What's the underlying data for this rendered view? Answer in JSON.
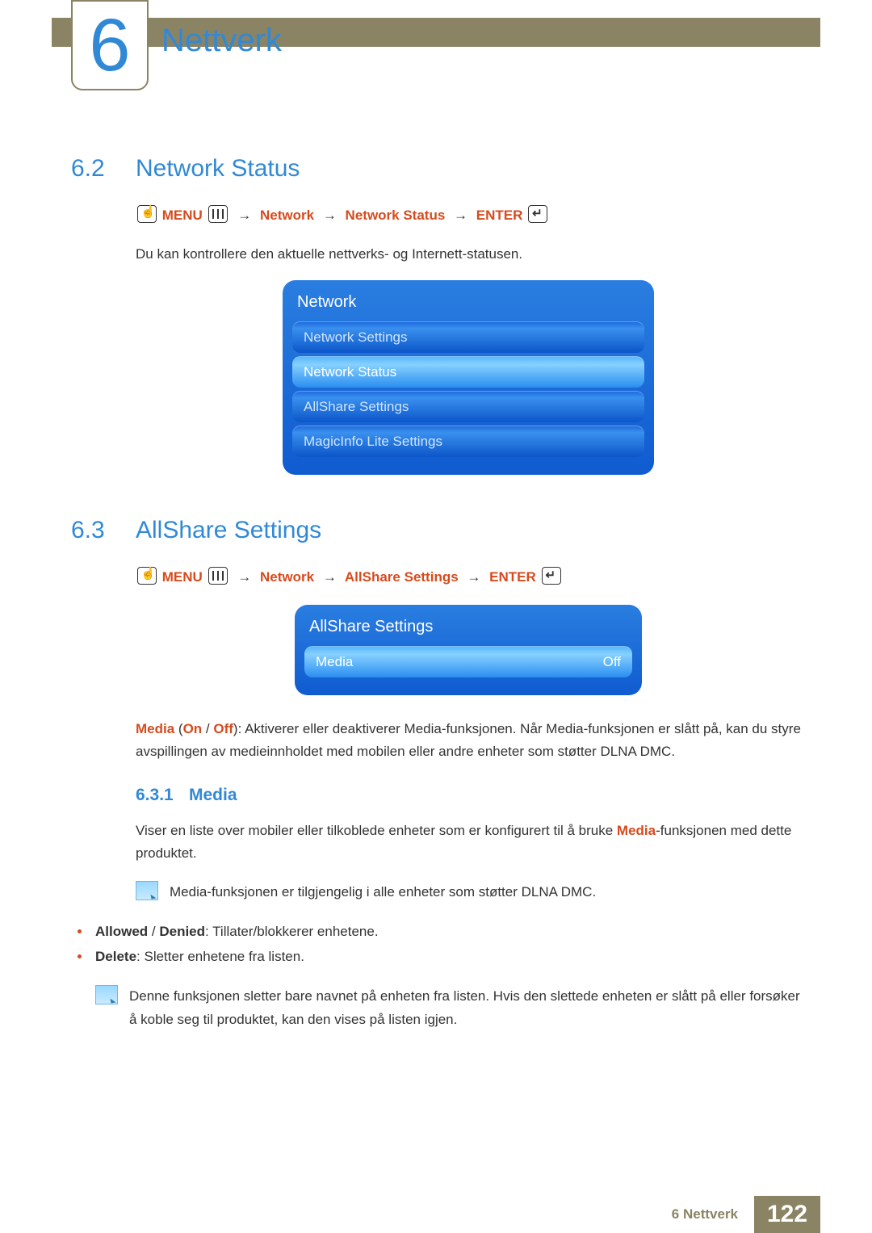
{
  "chapter": {
    "number": "6",
    "title": "Nettverk"
  },
  "sec62": {
    "num": "6.2",
    "title": "Network Status",
    "path": {
      "menu": "MENU",
      "n1": "Network",
      "n2": "Network Status",
      "enter": "ENTER"
    },
    "desc": "Du kan kontrollere den aktuelle nettverks- og Internett-statusen.",
    "panel": {
      "title": "Network",
      "items": [
        "Network Settings",
        "Network Status",
        "AllShare Settings",
        "MagicInfo Lite Settings"
      ],
      "selectedIndex": 1
    }
  },
  "sec63": {
    "num": "6.3",
    "title": "AllShare Settings",
    "path": {
      "menu": "MENU",
      "n1": "Network",
      "n2": "AllShare Settings",
      "enter": "ENTER"
    },
    "panel": {
      "title": "AllShare Settings",
      "row": {
        "label": "Media",
        "value": "Off"
      }
    },
    "mediaPara": {
      "kw": "Media",
      "open": " (",
      "on": "On",
      "slash": " / ",
      "off": "Off",
      "rest": "): Aktiverer eller deaktiverer Media-funksjonen. Når Media-funksjonen er slått på, kan du styre avspillingen av medieinnholdet med mobilen eller andre enheter som støtter DLNA DMC."
    }
  },
  "sec631": {
    "num": "6.3.1",
    "title": "Media",
    "para": {
      "pre": "Viser en liste over mobiler eller tilkoblede enheter som er konfigurert til å bruke ",
      "kw": "Media",
      "post": "-funksjonen med dette produktet."
    },
    "note1": "Media-funksjonen er tilgjengelig i alle enheter som støtter DLNA DMC.",
    "b1": {
      "allowed": "Allowed",
      "denied": "Denied",
      "rest": ": Tillater/blokkerer enhetene."
    },
    "b2": {
      "delete": "Delete",
      "rest": ": Sletter enhetene fra listen."
    },
    "note2": "Denne funksjonen sletter bare navnet på enheten fra listen. Hvis den slettede enheten er slått på eller forsøker å koble seg til produktet, kan den vises på listen igjen."
  },
  "footer": {
    "chapter": "6 Nettverk",
    "page": "122"
  }
}
